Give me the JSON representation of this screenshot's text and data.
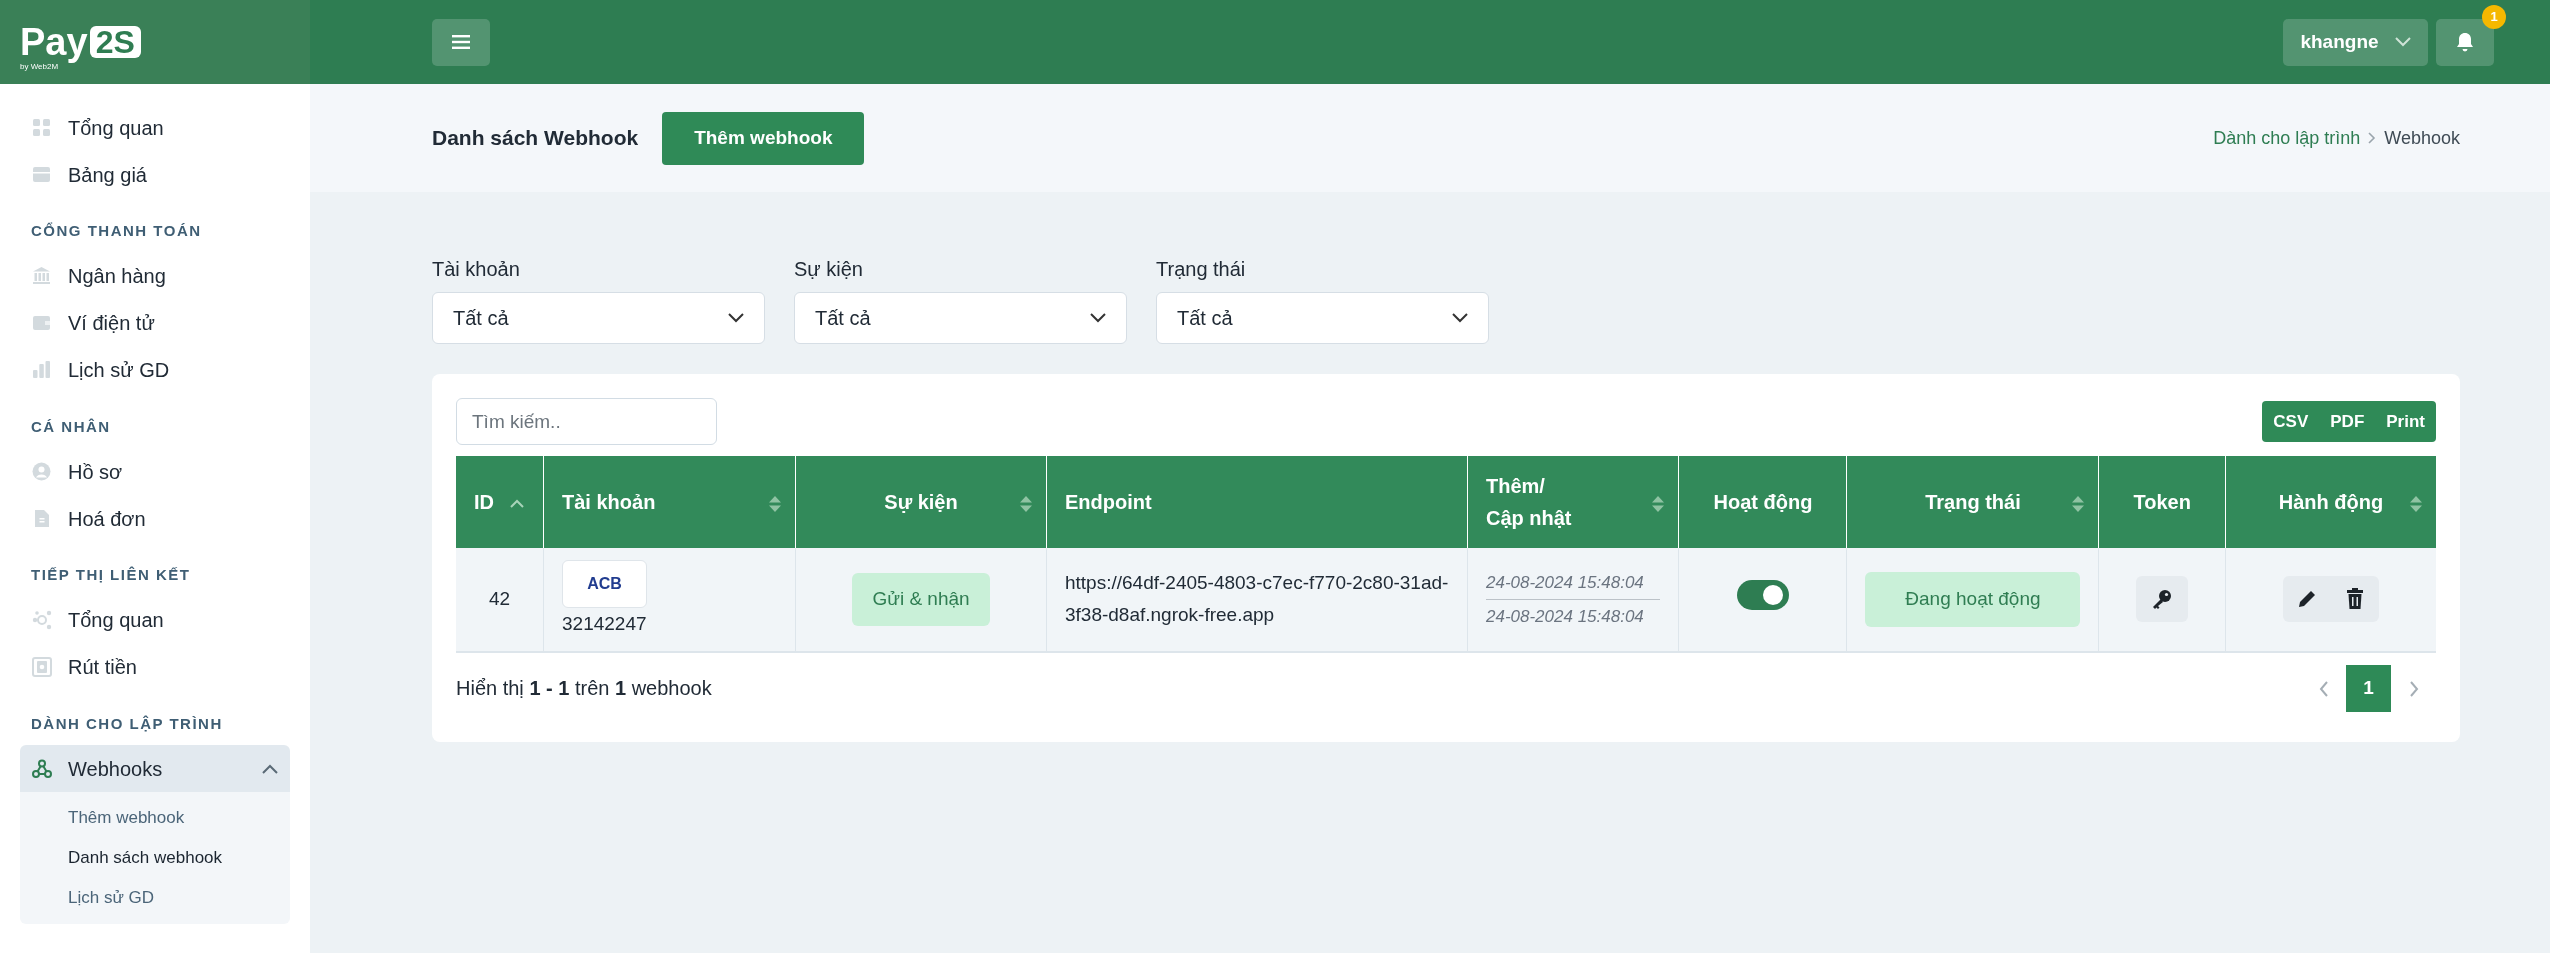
{
  "logo": {
    "name": "Pay",
    "badge": "2S",
    "tagline": "by Web2M"
  },
  "sidebar": {
    "sections": [
      {
        "items": [
          {
            "label": "Tổng quan",
            "selected": false
          },
          {
            "label": "Bảng giá",
            "selected": false
          }
        ]
      },
      {
        "heading": "CỔNG THANH TOÁN",
        "items": [
          {
            "label": "Ngân hàng",
            "selected": false
          },
          {
            "label": "Ví điện tử",
            "selected": false
          },
          {
            "label": "Lịch sử GD",
            "selected": false
          }
        ]
      },
      {
        "heading": "CÁ NHÂN",
        "items": [
          {
            "label": "Hồ sơ",
            "selected": false
          },
          {
            "label": "Hoá đơn",
            "selected": false
          }
        ]
      },
      {
        "heading": "TIẾP THỊ LIÊN KẾT",
        "items": [
          {
            "label": "Tổng quan",
            "selected": false
          },
          {
            "label": "Rút tiền",
            "selected": false
          }
        ]
      },
      {
        "heading": "DÀNH CHO LẬP TRÌNH",
        "items": [
          {
            "label": "Webhooks",
            "selected": true,
            "expanded": true,
            "children": [
              {
                "label": "Thêm webhook",
                "selected": false
              },
              {
                "label": "Danh sách webhook",
                "selected": true
              },
              {
                "label": "Lịch sử GD",
                "selected": false
              }
            ]
          }
        ]
      }
    ]
  },
  "topbar": {
    "user": "khangne",
    "notifications": "1"
  },
  "page": {
    "title": "Danh sách Webhook",
    "add_button": "Thêm webhook",
    "breadcrumb": [
      "Dành cho lập trình",
      "Webhook"
    ]
  },
  "filters": [
    {
      "label": "Tài khoản",
      "value": "Tất cả"
    },
    {
      "label": "Sự kiện",
      "value": "Tất cả"
    },
    {
      "label": "Trạng thái",
      "value": "Tất cả"
    }
  ],
  "search": {
    "placeholder": "Tìm kiếm.."
  },
  "export_buttons": [
    "CSV",
    "PDF",
    "Print"
  ],
  "table": {
    "columns": [
      {
        "label": "ID",
        "sortable": true,
        "sorted": true
      },
      {
        "label": "Tài khoản",
        "sortable": true,
        "sorted": false
      },
      {
        "label": "Sự kiện",
        "sortable": true,
        "sorted": false
      },
      {
        "label": "Endpoint",
        "sortable": false
      },
      {
        "label": "Thêm/\nCập nhật",
        "sortable": true,
        "sorted": false
      },
      {
        "label": "Hoạt động",
        "sortable": false
      },
      {
        "label": "Trạng thái",
        "sortable": true,
        "sorted": false
      },
      {
        "label": "Token",
        "sortable": false
      },
      {
        "label": "Hành động",
        "sortable": true,
        "sorted": false
      }
    ],
    "rows": [
      {
        "id": "42",
        "bank": "ACB",
        "account": "32142247",
        "event": "Gửi & nhận",
        "endpoint": "https://64df-2405-4803-c7ec-f770-2c80-31ad-3f38-d8af.ngrok-free.app",
        "added": "24-08-2024 15:48:04",
        "updated": "24-08-2024 15:48:04",
        "on": true,
        "status": "Đang hoạt động"
      }
    ]
  },
  "summary": "Hiển thị **1 - 1** trên **1** webhook",
  "pagination": {
    "pages": [
      {
        "label": "1",
        "selected": true
      }
    ]
  }
}
